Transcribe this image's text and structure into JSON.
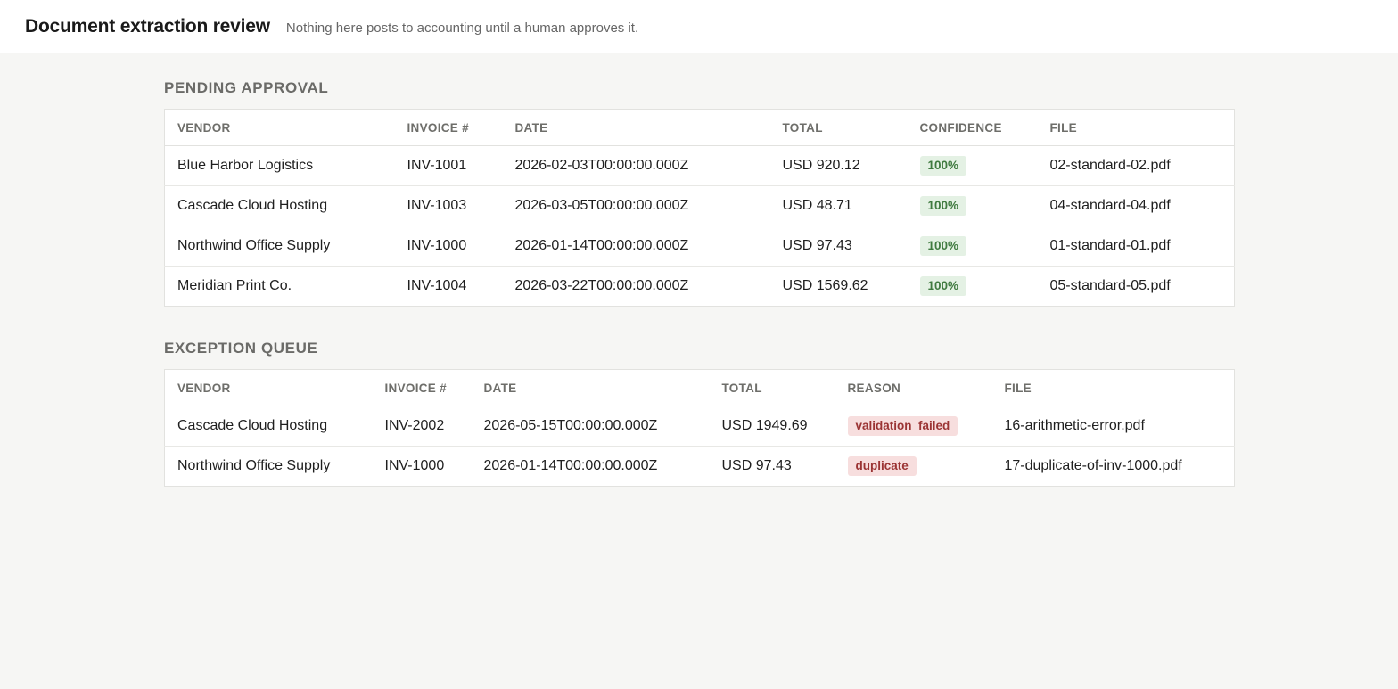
{
  "header": {
    "title": "Document extraction review",
    "subtitle": "Nothing here posts to accounting until a human approves it."
  },
  "pending": {
    "heading": "PENDING APPROVAL",
    "columns": [
      "VENDOR",
      "INVOICE #",
      "DATE",
      "TOTAL",
      "CONFIDENCE",
      "FILE"
    ],
    "rows": [
      {
        "vendor": "Blue Harbor Logistics",
        "invoice": "INV-1001",
        "date": "2026-02-03T00:00:00.000Z",
        "total": "USD 920.12",
        "confidence": "100%",
        "file": "02-standard-02.pdf"
      },
      {
        "vendor": "Cascade Cloud Hosting",
        "invoice": "INV-1003",
        "date": "2026-03-05T00:00:00.000Z",
        "total": "USD 48.71",
        "confidence": "100%",
        "file": "04-standard-04.pdf"
      },
      {
        "vendor": "Northwind Office Supply",
        "invoice": "INV-1000",
        "date": "2026-01-14T00:00:00.000Z",
        "total": "USD 97.43",
        "confidence": "100%",
        "file": "01-standard-01.pdf"
      },
      {
        "vendor": "Meridian Print Co.",
        "invoice": "INV-1004",
        "date": "2026-03-22T00:00:00.000Z",
        "total": "USD 1569.62",
        "confidence": "100%",
        "file": "05-standard-05.pdf"
      }
    ]
  },
  "exceptions": {
    "heading": "EXCEPTION QUEUE",
    "columns": [
      "VENDOR",
      "INVOICE #",
      "DATE",
      "TOTAL",
      "REASON",
      "FILE"
    ],
    "rows": [
      {
        "vendor": "Cascade Cloud Hosting",
        "invoice": "INV-2002",
        "date": "2026-05-15T00:00:00.000Z",
        "total": "USD 1949.69",
        "reason": "validation_failed",
        "file": "16-arithmetic-error.pdf"
      },
      {
        "vendor": "Northwind Office Supply",
        "invoice": "INV-1000",
        "date": "2026-01-14T00:00:00.000Z",
        "total": "USD 97.43",
        "reason": "duplicate",
        "file": "17-duplicate-of-inv-1000.pdf"
      }
    ]
  },
  "colors": {
    "page_bg": "#f6f6f4",
    "ok_badge_bg": "#e4f1e4",
    "ok_badge_text": "#3f7a3f",
    "bad_badge_bg": "#f7dede",
    "bad_badge_text": "#9b3434"
  }
}
